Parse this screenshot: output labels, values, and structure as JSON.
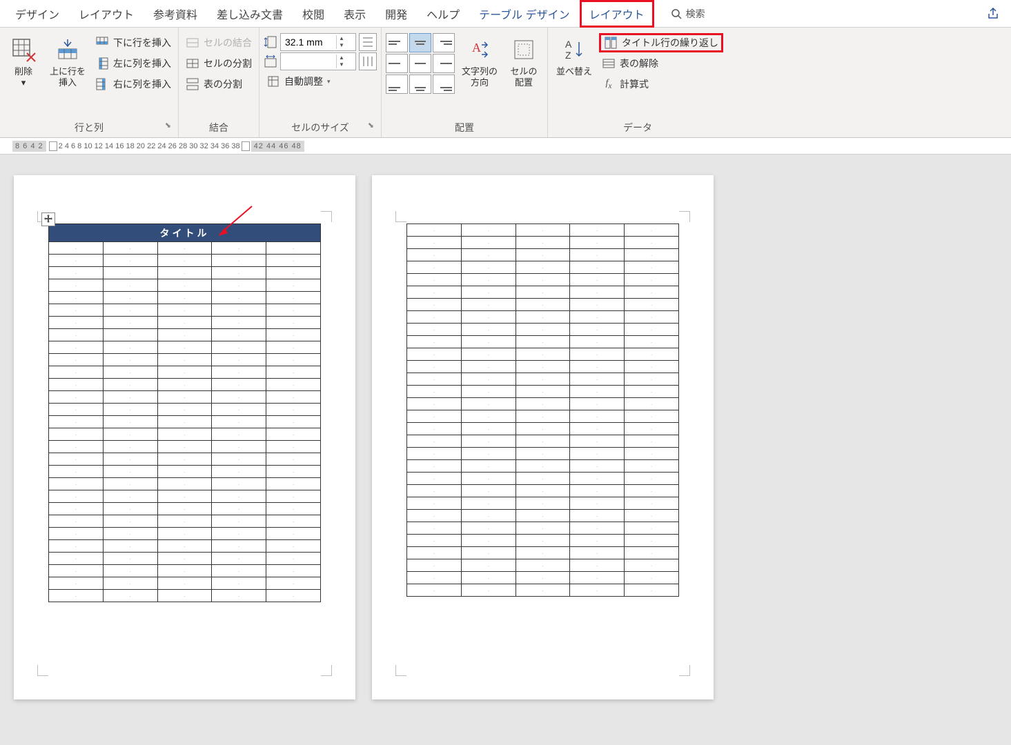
{
  "tabs": {
    "design": "デザイン",
    "layout1": "レイアウト",
    "references": "参考資料",
    "mailings": "差し込み文書",
    "review": "校閲",
    "view": "表示",
    "developer": "開発",
    "help": "ヘルプ",
    "table_design": "テーブル デザイン",
    "table_layout": "レイアウト",
    "search": "検索"
  },
  "groups": {
    "rows_cols": {
      "label": "行と列",
      "delete": "削除",
      "insert_above": "上に行を\n挿入",
      "insert_below": "下に行を挿入",
      "insert_left": "左に列を挿入",
      "insert_right": "右に列を挿入"
    },
    "merge": {
      "label": "結合",
      "merge_cells": "セルの結合",
      "split_cells": "セルの分割",
      "split_table": "表の分割"
    },
    "cell_size": {
      "label": "セルのサイズ",
      "height_value": "32.1 mm",
      "width_value": "",
      "autofit": "自動調整"
    },
    "alignment": {
      "label": "配置",
      "text_direction": "文字列の\n方向",
      "cell_margins": "セルの\n配置"
    },
    "data": {
      "label": "データ",
      "sort": "並べ替え",
      "repeat_header": "タイトル行の繰り返し",
      "convert": "表の解除",
      "formula": "計算式"
    }
  },
  "document": {
    "table_title": "タイトル",
    "columns": 5,
    "rows_page1": 29,
    "rows_page2": 30
  },
  "ruler": {
    "left": "8 6 4 2",
    "right": "2  4  6  8 10 12 14 16 18 20 22 24 26 28 30 32 34 36 38",
    "right2": "42 44 46 48"
  }
}
